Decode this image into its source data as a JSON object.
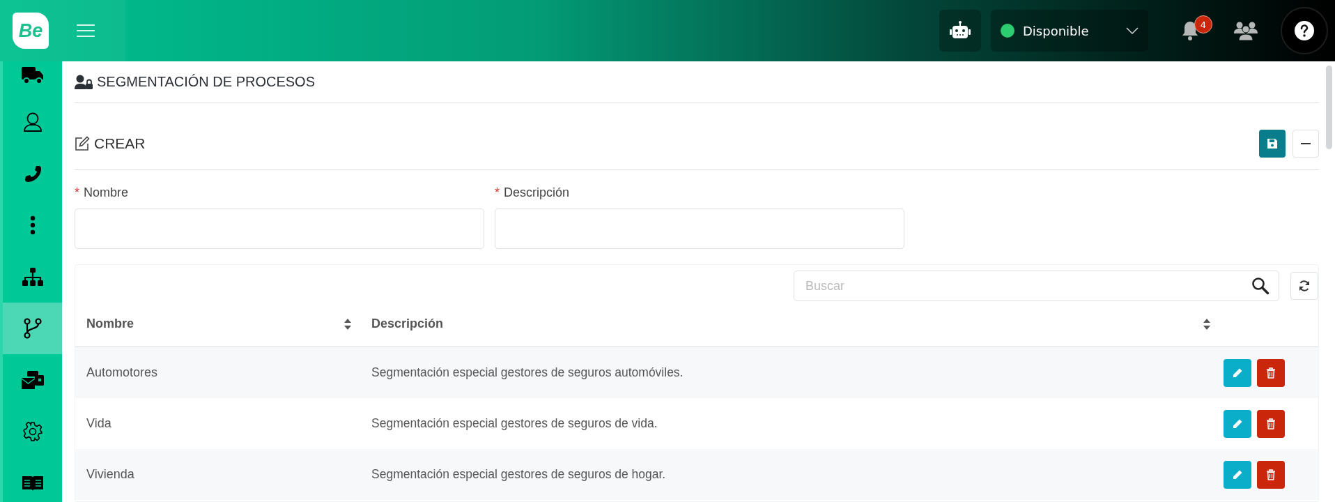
{
  "header": {
    "logo": "Be",
    "status": {
      "label": "Disponible",
      "color": "#2ecc71"
    },
    "notifications": {
      "count": "4"
    }
  },
  "sidebar": {
    "items": [
      {
        "kind": "truck",
        "selected": false
      },
      {
        "kind": "user",
        "selected": false
      },
      {
        "kind": "phone",
        "selected": false
      },
      {
        "kind": "dots",
        "selected": false
      },
      {
        "kind": "org",
        "selected": false
      },
      {
        "kind": "branch",
        "selected": true
      },
      {
        "kind": "mail",
        "selected": false
      },
      {
        "kind": "gear",
        "selected": false
      },
      {
        "kind": "book",
        "selected": false
      }
    ]
  },
  "page": {
    "title": "SEGMENTACIÓN DE PROCESOS"
  },
  "form": {
    "title": "CREAR",
    "fields": [
      {
        "label": "Nombre",
        "required_mark": "*"
      },
      {
        "label": "Descripción",
        "required_mark": "*"
      }
    ]
  },
  "table": {
    "search": {
      "placeholder": "Buscar"
    },
    "columns": [
      {
        "label": "Nombre",
        "sortable": true
      },
      {
        "label": "Descripción",
        "sortable": true
      }
    ],
    "rows": [
      {
        "name": "Automotores",
        "description": "Segmentación especial gestores de seguros automóviles."
      },
      {
        "name": "Vida",
        "description": "Segmentación especial gestores de seguros de vida."
      },
      {
        "name": "Vivienda",
        "description": "Segmentación especial gestores de seguros de hogar."
      }
    ]
  }
}
